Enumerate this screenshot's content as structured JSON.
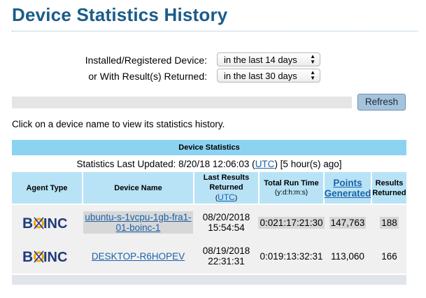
{
  "page": {
    "title": "Device Statistics History"
  },
  "filters": {
    "installed_label": "Installed/Registered Device:",
    "installed_value": "in the last 14 days",
    "returned_label": "or With Result(s) Returned:",
    "returned_value": "in the last 30 days"
  },
  "refresh_label": "Refresh",
  "hint": "Click on a device name to view its statistics history.",
  "table": {
    "caption": "Device Statistics",
    "updated_prefix": "Statistics Last Updated: 8/20/18 12:06:03 (",
    "updated_link": "UTC",
    "updated_suffix": ") [5 hour(s) ago]",
    "headers": {
      "agent_type": "Agent Type",
      "device_name": "Device Name",
      "last_results_1": "Last Results",
      "last_results_2": "Returned",
      "last_results_utc": "UTC",
      "total_run_time": "Total Run Time",
      "total_run_time_sub": "(y:d:h:m:s)",
      "points_1": "Points",
      "points_2": "Generated",
      "results_1": "Results",
      "results_2": "Returned"
    },
    "rows": [
      {
        "agent_logo": "boinc-logo",
        "device_name": "ubuntu-s-1vcpu-1gb-fra1-01-boinc-1",
        "last_date": "08/20/2018",
        "last_time": "15:54:54",
        "run_time": "0:021:17:21:30",
        "points": "147,763",
        "results": "188"
      },
      {
        "agent_logo": "boinc-logo",
        "device_name": "DESKTOP-R6HOPEV",
        "last_date": "08/19/2018",
        "last_time": "22:31:31",
        "run_time": "0:019:13:32:31",
        "points": "113,060",
        "results": "166"
      }
    ]
  },
  "logo_text": {
    "b": "B",
    "inc": "INC"
  },
  "colors": {
    "title": "#1a5c8a",
    "header": "#8cd3f2",
    "col_header": "#b8e3f6",
    "link": "#1a62a8"
  }
}
